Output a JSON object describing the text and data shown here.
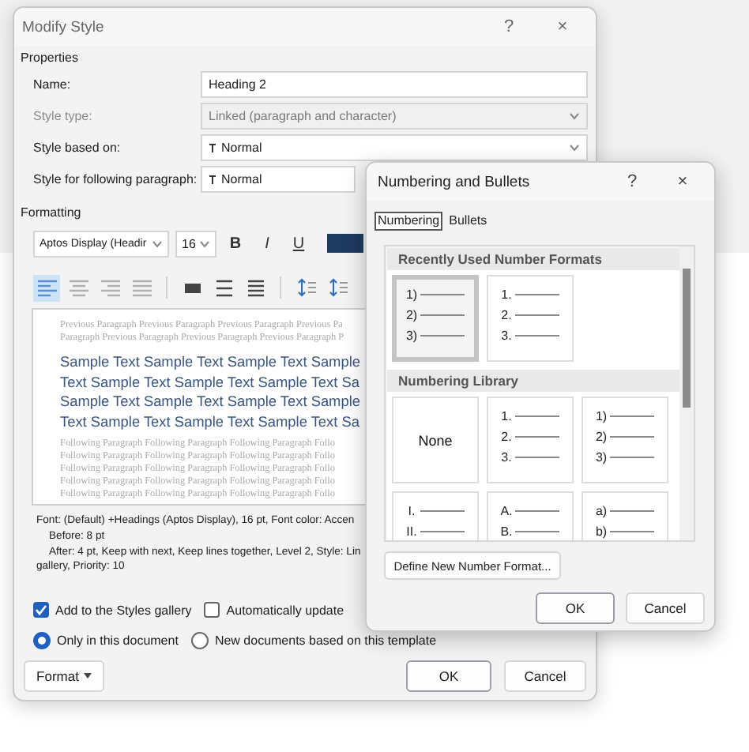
{
  "modify_style": {
    "title": "Modify Style",
    "help": "?",
    "close": "×",
    "properties_label": "Properties",
    "fields": [
      {
        "label": "Name:",
        "value": "Heading 2",
        "kind": "text",
        "disabled": false
      },
      {
        "label": "Style type:",
        "value": "Linked (paragraph and character)",
        "kind": "dropdown",
        "disabled": true
      },
      {
        "label": "Style based on:",
        "value": "Normal",
        "kind": "style-dropdown",
        "disabled": false
      },
      {
        "label": "Style for following paragraph:",
        "value": "Normal",
        "kind": "style-field",
        "disabled": false
      }
    ],
    "formatting_label": "Formatting",
    "font": "Aptos Display (Headir",
    "size": "16",
    "styles": [
      {
        "label": "B",
        "kind": "bold"
      },
      {
        "label": "I",
        "kind": "italic"
      },
      {
        "label": "U",
        "kind": "underline"
      }
    ],
    "alignments": [
      {
        "selected": true
      },
      {
        "selected": false
      },
      {
        "selected": false
      },
      {
        "selected": false
      }
    ],
    "preview": {
      "previous": [
        "Previous Paragraph Previous Paragraph Previous Paragraph Previous Pa",
        "Paragraph Previous Paragraph Previous Paragraph Previous Paragraph P"
      ],
      "sample": [
        "Sample Text Sample Text Sample Text Sample",
        "Text Sample Text Sample Text Sample Text Sa",
        "Sample Text Sample Text Sample Text Sample",
        "Text Sample Text Sample Text Sample Text Sa"
      ],
      "following": [
        "Following Paragraph Following Paragraph Following Paragraph Follo",
        "Following Paragraph Following Paragraph Following Paragraph Follo",
        "Following Paragraph Following Paragraph Following Paragraph Follo",
        "Following Paragraph Following Paragraph Following Paragraph Follo",
        "Following Paragraph Following Paragraph Following Paragraph Follo"
      ]
    },
    "description": [
      {
        "text": "Font: (Default) +Headings (Aptos Display), 16 pt, Font color: Accen",
        "indent": false
      },
      {
        "text": "Before:  8 pt",
        "indent": true
      },
      {
        "text": "After:  4 pt, Keep with next, Keep lines together, Level 2, Style: Lin",
        "indent": true
      },
      {
        "text": "gallery, Priority: 10",
        "indent": false
      }
    ],
    "checkboxes": [
      {
        "label": "Add to the Styles gallery",
        "checked": true
      },
      {
        "label": "Automatically update",
        "checked": false
      }
    ],
    "radios": [
      {
        "label": "Only in this document",
        "selected": true
      },
      {
        "label": "New documents based on this template",
        "selected": false
      }
    ],
    "format_button": "Format",
    "ok": "OK",
    "cancel": "Cancel"
  },
  "numbering_dialog": {
    "title": "Numbering and Bullets",
    "help": "?",
    "close": "×",
    "tabs": [
      {
        "label": "Numbering",
        "selected": true
      },
      {
        "label": "Bullets",
        "selected": false
      }
    ],
    "sections": [
      {
        "title": "Recently Used Number Formats",
        "tiles": [
          {
            "kind": "list",
            "lines": [
              "1)",
              "2)",
              "3)"
            ],
            "selected": true
          },
          {
            "kind": "list",
            "lines": [
              "1.",
              "2.",
              "3."
            ],
            "selected": false
          }
        ]
      },
      {
        "title": "Numbering Library",
        "tiles": [
          {
            "kind": "none",
            "text": "None",
            "selected": false
          },
          {
            "kind": "list",
            "lines": [
              "1.",
              "2.",
              "3."
            ],
            "selected": false
          },
          {
            "kind": "list",
            "lines": [
              "1)",
              "2)",
              "3)"
            ],
            "selected": false
          },
          {
            "kind": "list",
            "lines": [
              "I.",
              "II."
            ],
            "selected": false
          },
          {
            "kind": "list",
            "lines": [
              "A.",
              "B."
            ],
            "selected": false
          },
          {
            "kind": "list",
            "lines": [
              "a)",
              "b)"
            ],
            "selected": false
          }
        ]
      }
    ],
    "define_button": "Define New Number Format...",
    "ok": "OK",
    "cancel": "Cancel"
  }
}
